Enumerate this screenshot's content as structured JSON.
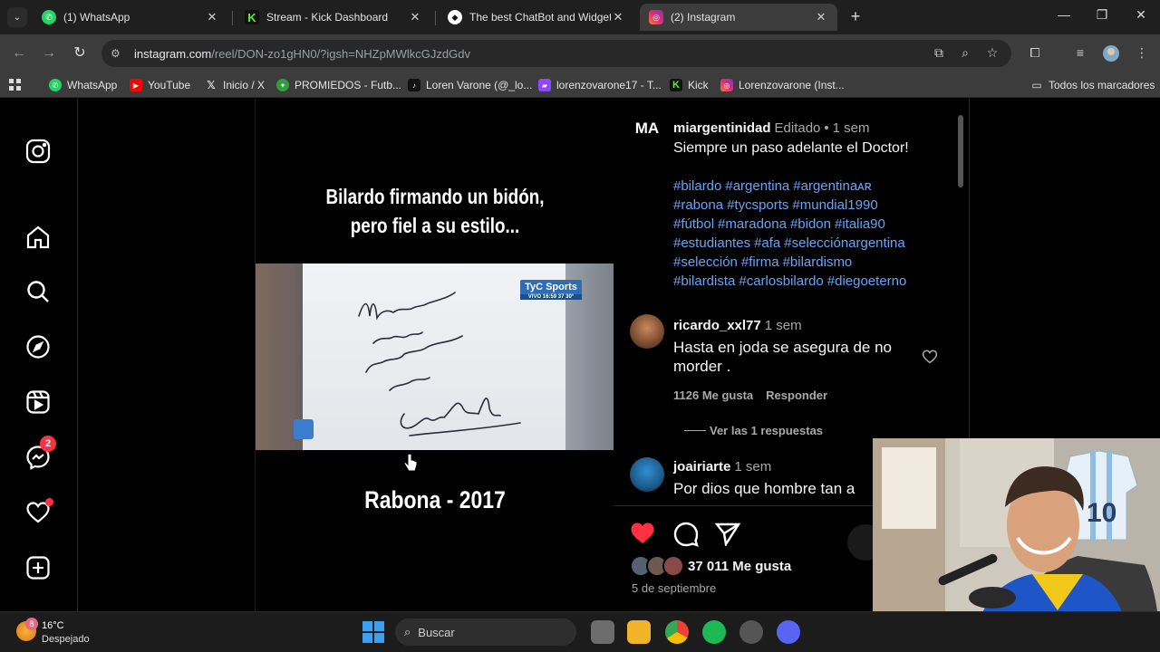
{
  "tabs": [
    {
      "title": "(1) WhatsApp",
      "icon": "whatsapp-icon",
      "color": "#25d366"
    },
    {
      "title": "Stream - Kick Dashboard",
      "icon": "kick-icon",
      "color": "#53fc18"
    },
    {
      "title": "The best ChatBot and Widgets f",
      "icon": "botrix-icon",
      "color": "#ffffff"
    },
    {
      "title": "(2) Instagram",
      "icon": "instagram-icon",
      "color": "#e1306c"
    }
  ],
  "url": {
    "host": "instagram.com",
    "path": "/reel/DON-zo1gHN0/?igsh=NHZpMWlkcGJzdGdv"
  },
  "bookmarks": [
    {
      "label": "WhatsApp",
      "icon": "whatsapp-icon"
    },
    {
      "label": "YouTube",
      "icon": "youtube-icon"
    },
    {
      "label": "Inicio / X",
      "icon": "x-icon"
    },
    {
      "label": "PROMIEDOS - Futb...",
      "icon": "promiedos-icon"
    },
    {
      "label": "Loren Varone (@_lo...",
      "icon": "tiktok-icon"
    },
    {
      "label": "lorenzovarone17 - T...",
      "icon": "twitch-icon"
    },
    {
      "label": "Kick",
      "icon": "kick-icon"
    },
    {
      "label": "Lorenzovarone (Inst...",
      "icon": "instagram-icon"
    }
  ],
  "bookmarks_all": "Todos los marcadores",
  "sidebar": {
    "messages_badge": "2"
  },
  "video": {
    "caption_top_1": "Bilardo firmando un bidón,",
    "caption_top_2": "pero fiel a su estilo...",
    "caption_bottom": "Rabona - 2017",
    "channel_logo": "TyC Sports",
    "channel_live": "VIVO 16:59 37 30°"
  },
  "post": {
    "avatar_text": "MA",
    "author": "miargentinidad",
    "edited": "Editado",
    "time": "1 sem",
    "caption": "Siempre un paso adelante el Doctor!",
    "hashtags": [
      "#bilardo",
      "#argentina",
      "#argentinaᴀʀ",
      "#rabona",
      "#tycsports",
      "#mundial1990",
      "#fútbol",
      "#maradona",
      "#bidon",
      "#italia90",
      "#estudiantes",
      "#afa",
      "#selecciónargentina",
      "#selección",
      "#firma",
      "#bilardismo",
      "#bilardista",
      "#carlosbilardo",
      "#diegoeterno"
    ]
  },
  "comments": [
    {
      "user": "ricardo_xxl77",
      "time": "1 sem",
      "text": "Hasta en joda se asegura de no morder .",
      "likes": "1126 Me gusta",
      "reply": "Responder",
      "view_replies": "Ver las 1 respuestas"
    },
    {
      "user": "joairiarte",
      "time": "1 sem",
      "text": "Por dios que hombre tan a"
    }
  ],
  "likes_count": "37 011 Me gusta",
  "post_date": "5 de septiembre",
  "taskbar": {
    "temp": "16°C",
    "weather": "Despejado",
    "weather_badge": "8",
    "search_placeholder": "Buscar"
  }
}
